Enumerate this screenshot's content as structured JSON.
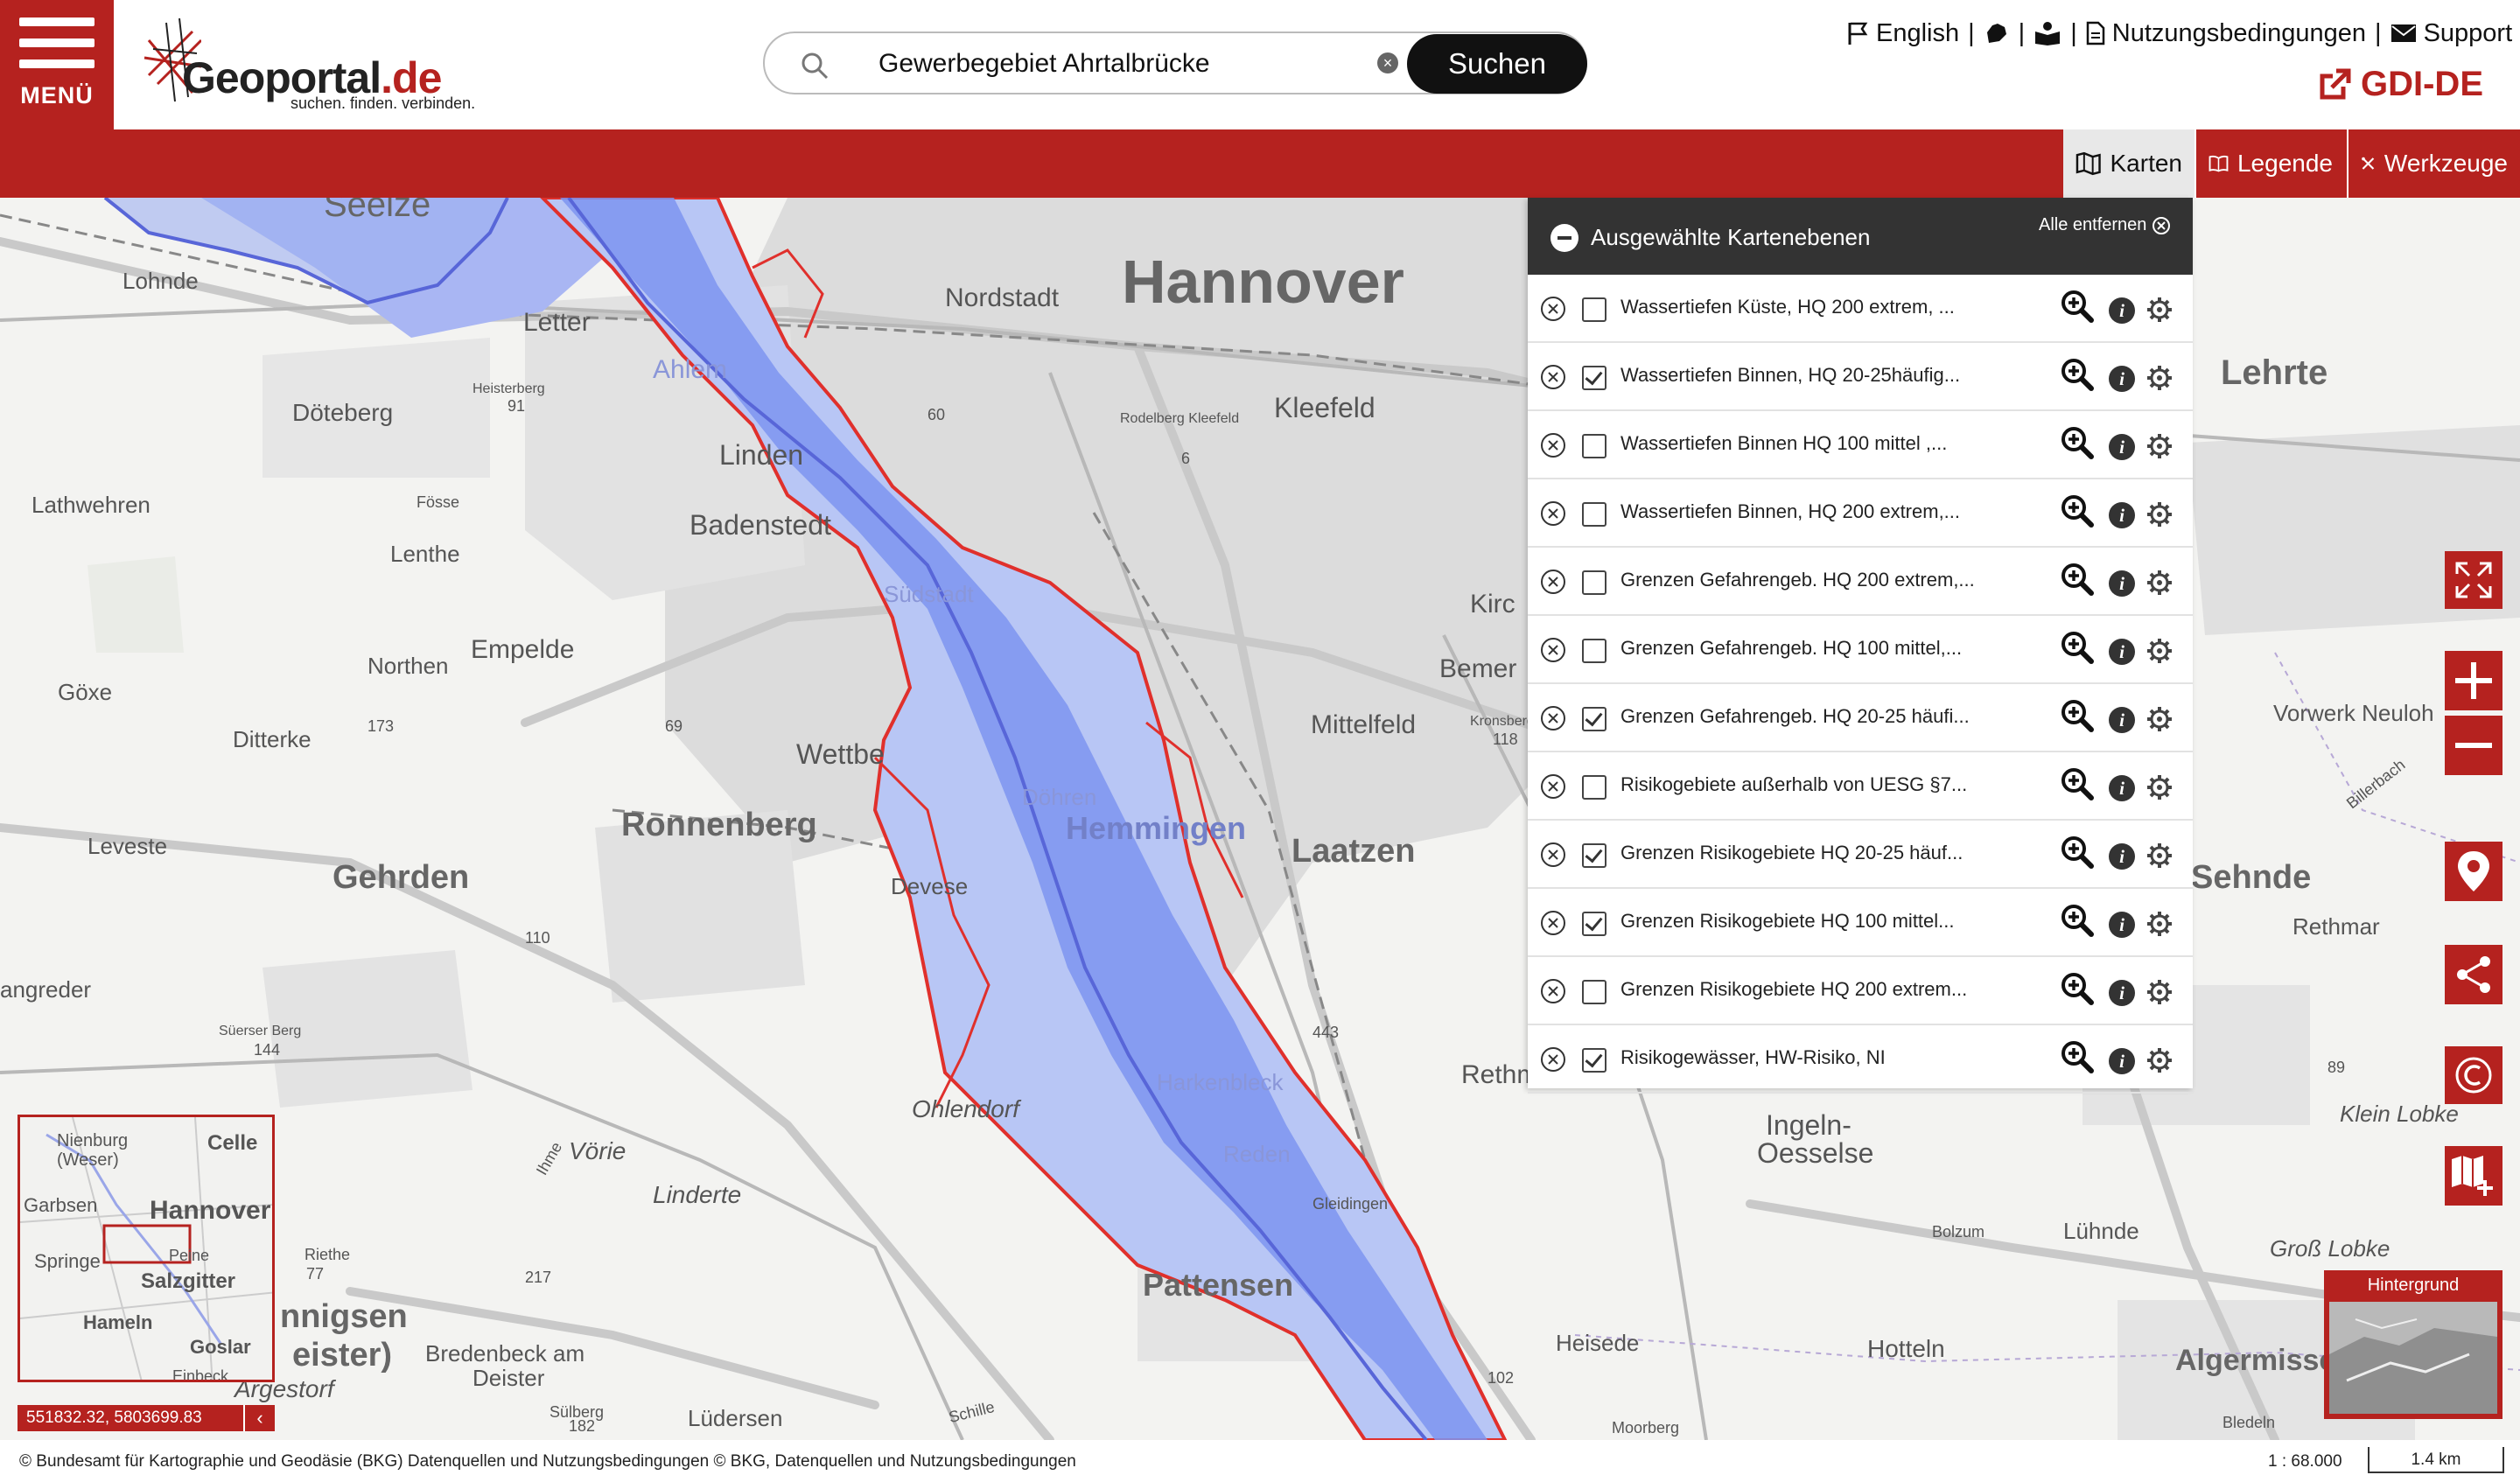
{
  "header": {
    "menu_label": "MENÜ",
    "logo_name": "Geoportal",
    "logo_tld": ".de",
    "logo_tagline": "suchen. finden. verbinden.",
    "search_value": "Gewerbegebiet Ahrtalbrücke",
    "search_button": "Suchen",
    "links": {
      "english": "English",
      "terms": "Nutzungsbedingungen",
      "support": "Support"
    },
    "gdi_label": "GDI-DE"
  },
  "tabs": {
    "maps": "Karten",
    "legend": "Legende",
    "tools": "Werkzeuge"
  },
  "layer_panel": {
    "title": "Ausgewählte Kartenebenen",
    "remove_all": "Alle entfernen",
    "layers": [
      {
        "label": "Wassertiefen Küste, HQ 200 extrem, ...",
        "checked": false
      },
      {
        "label": "Wassertiefen Binnen, HQ 20-25häufig...",
        "checked": true
      },
      {
        "label": "Wassertiefen Binnen HQ 100 mittel ,...",
        "checked": false
      },
      {
        "label": "Wassertiefen Binnen, HQ 200 extrem,...",
        "checked": false
      },
      {
        "label": "Grenzen Gefahrengeb. HQ 200 extrem,...",
        "checked": false
      },
      {
        "label": "Grenzen Gefahrengeb. HQ 100 mittel,...",
        "checked": false
      },
      {
        "label": "Grenzen Gefahrengeb. HQ 20-25 häufi...",
        "checked": true
      },
      {
        "label": "Risikogebiete außerhalb von UESG §7...",
        "checked": false
      },
      {
        "label": "Grenzen Risikogebiete HQ 20-25 häuf...",
        "checked": true
      },
      {
        "label": "Grenzen Risikogebiete HQ 100 mittel...",
        "checked": true
      },
      {
        "label": "Grenzen Risikogebiete HQ 200 extrem...",
        "checked": false
      },
      {
        "label": "Risikogewässer, HW-Risiko, NI",
        "checked": true
      }
    ]
  },
  "map_labels": [
    {
      "text": "Hannover",
      "size": 70,
      "bold": true
    },
    {
      "text": "Nordstadt",
      "size": 30
    },
    {
      "text": "Lehrte",
      "size": 40,
      "bold": true
    },
    {
      "text": "Kleefeld",
      "size": 32
    },
    {
      "text": "Rodelberg Kleefeld",
      "size": 16
    },
    {
      "text": "Linden",
      "size": 32
    },
    {
      "text": "Badenstedt",
      "size": 32
    },
    {
      "text": "Döteberg",
      "size": 28
    },
    {
      "text": "Lathwehren",
      "size": 26
    },
    {
      "text": "Lenthe",
      "size": 26
    },
    {
      "text": "Northen",
      "size": 26
    },
    {
      "text": "Empelde",
      "size": 30
    },
    {
      "text": "Göxe",
      "size": 26
    },
    {
      "text": "Ditterke",
      "size": 26
    },
    {
      "text": "Wettbe",
      "size": 32
    },
    {
      "text": "Ronnenberg",
      "size": 38,
      "bold": true
    },
    {
      "text": "Leveste",
      "size": 26
    },
    {
      "text": "Gehrden",
      "size": 38,
      "bold": true
    },
    {
      "text": "angreder",
      "size": 26
    },
    {
      "text": "Devese",
      "size": 26
    },
    {
      "text": "Laatzen",
      "size": 38,
      "bold": true
    },
    {
      "text": "Mittelfeld",
      "size": 30
    },
    {
      "text": "Bemer",
      "size": 30
    },
    {
      "text": "Kirc",
      "size": 30
    },
    {
      "text": "Vorwerk Neuloh",
      "size": 26
    },
    {
      "text": "Sehnde",
      "size": 38,
      "bold": true
    },
    {
      "text": "Rethmar",
      "size": 26
    },
    {
      "text": "Billerbach",
      "size": 18
    },
    {
      "text": "Klein Lobke",
      "size": 26
    },
    {
      "text": "Ingeln-",
      "size": 32
    },
    {
      "text": "Oesselse",
      "size": 32
    },
    {
      "text": "Lühnde",
      "size": 26
    },
    {
      "text": "Groß Lobke",
      "size": 26
    },
    {
      "text": "Ohlendorf",
      "size": 28
    },
    {
      "text": "Vörie",
      "size": 28
    },
    {
      "text": "Linderte",
      "size": 28
    },
    {
      "text": "Pattensen",
      "size": 36,
      "bold": true
    },
    {
      "text": "Heisede",
      "size": 26
    },
    {
      "text": "Hotteln",
      "size": 28
    },
    {
      "text": "Algermisse",
      "size": 34,
      "bold": true
    },
    {
      "text": "Bredenbeck am",
      "size": 26
    },
    {
      "text": "Deister",
      "size": 26
    },
    {
      "text": "Argestorf",
      "size": 28
    },
    {
      "text": "Lüdersen",
      "size": 26
    },
    {
      "text": "Süerser Berg",
      "size": 16
    },
    {
      "text": "Heisterberg",
      "size": 16
    },
    {
      "text": "Lohnde",
      "size": 26
    },
    {
      "text": "Letter",
      "size": 30
    },
    {
      "text": "Rethm",
      "size": 30
    },
    {
      "text": "nnigsen",
      "size": 38,
      "bold": true
    },
    {
      "text": "eister)",
      "size": 38,
      "bold": true
    },
    {
      "text": "Riethe",
      "size": 18
    },
    {
      "text": "Moorberg",
      "size": 18
    },
    {
      "text": "Bolzum",
      "size": 18
    },
    {
      "text": "Gleidingen",
      "size": 18
    },
    {
      "text": "Schille",
      "size": 18
    },
    {
      "text": "Sülberg",
      "size": 18
    },
    {
      "text": "Bledeln",
      "size": 18
    },
    {
      "text": "Kronsberg",
      "size": 16
    },
    {
      "text": "Ihme",
      "size": 18
    },
    {
      "text": "Fösse",
      "size": 18
    },
    {
      "text": "Harkenbleck",
      "size": 26
    },
    {
      "text": "Reden",
      "size": 26
    },
    {
      "text": "Hemmingen",
      "size": 36,
      "bold": true
    },
    {
      "text": "Döhren",
      "size": 26
    },
    {
      "text": "Südstadt",
      "size": 26
    },
    {
      "text": "Ahlem",
      "size": 30
    },
    {
      "text": "Seelze",
      "size": 40
    }
  ],
  "overview": {
    "labels": [
      "Nienburg (Weser)",
      "Celle",
      "Garbsen",
      "Hannover",
      "Springe",
      "Peine",
      "Salzgitter",
      "Hameln",
      "Goslar",
      "Einbeck"
    ]
  },
  "coordinates": "551832.32, 5803699.83",
  "background_switch": "Hintergrund",
  "footer": {
    "copyright": "© Bundesamt für Kartographie und Geodäsie (BKG) Datenquellen und Nutzungsbedingungen  © BKG, Datenquellen und Nutzungsbedingungen",
    "scale": "1 : 68.000",
    "scalebar": "1.4 km"
  },
  "colors": {
    "brand_red": "#b5221f",
    "flood_blue": "#7d94f0",
    "boundary_red": "#e0302c"
  }
}
